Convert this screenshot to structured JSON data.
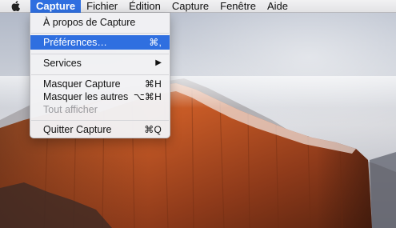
{
  "menubar": {
    "apple_icon": "apple-logo-icon",
    "items": [
      {
        "label": "Capture"
      },
      {
        "label": "Fichier"
      },
      {
        "label": "Édition"
      },
      {
        "label": "Capture"
      },
      {
        "label": "Fenêtre"
      },
      {
        "label": "Aide"
      }
    ]
  },
  "app_menu": {
    "about": {
      "label": "À propos de Capture"
    },
    "preferences": {
      "label": "Préférences…",
      "shortcut": "⌘,"
    },
    "services": {
      "label": "Services",
      "arrow": "▶"
    },
    "hide": {
      "label": "Masquer Capture",
      "shortcut": "⌘H"
    },
    "hide_others": {
      "label": "Masquer les autres",
      "shortcut": "⌥⌘H"
    },
    "show_all": {
      "label": "Tout afficher"
    },
    "quit": {
      "label": "Quitter Capture",
      "shortcut": "⌘Q"
    }
  },
  "colors": {
    "highlight": "#2f6fe0",
    "menubar": "#ececee",
    "disabled_text": "#9a9a9e"
  }
}
